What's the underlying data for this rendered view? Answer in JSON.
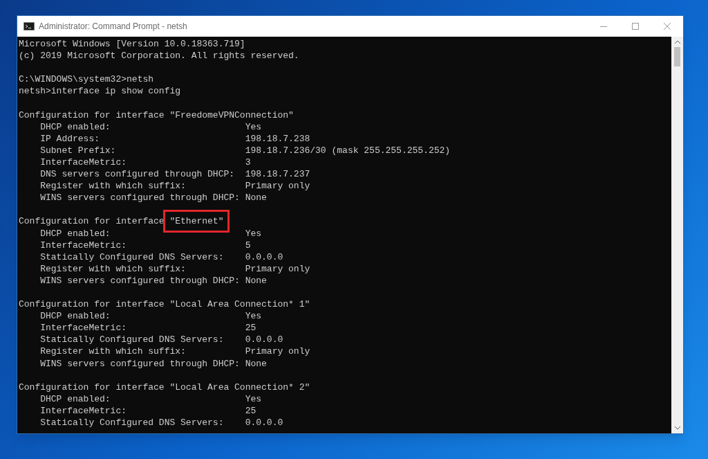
{
  "window": {
    "title": "Administrator: Command Prompt - netsh"
  },
  "console": {
    "lines": [
      {
        "kind": "text",
        "text": "Microsoft Windows [Version 10.0.18363.719]"
      },
      {
        "kind": "text",
        "text": "(c) 2019 Microsoft Corporation. All rights reserved."
      },
      {
        "kind": "blank"
      },
      {
        "kind": "text",
        "text": "C:\\WINDOWS\\system32>netsh"
      },
      {
        "kind": "text",
        "text": "netsh>interface ip show config"
      },
      {
        "kind": "blank"
      },
      {
        "kind": "text",
        "text": "Configuration for interface \"FreedomeVPNConnection\""
      },
      {
        "kind": "text",
        "text": "    DHCP enabled:                         Yes"
      },
      {
        "kind": "text",
        "text": "    IP Address:                           198.18.7.238"
      },
      {
        "kind": "text",
        "text": "    Subnet Prefix:                        198.18.7.236/30 (mask 255.255.255.252)"
      },
      {
        "kind": "text",
        "text": "    InterfaceMetric:                      3"
      },
      {
        "kind": "text",
        "text": "    DNS servers configured through DHCP:  198.18.7.237"
      },
      {
        "kind": "text",
        "text": "    Register with which suffix:           Primary only"
      },
      {
        "kind": "text",
        "text": "    WINS servers configured through DHCP: None"
      },
      {
        "kind": "blank"
      },
      {
        "kind": "parts",
        "parts": [
          {
            "text": "Configuration for interface ",
            "highlighted": false
          },
          {
            "text": "\"Ethernet\"",
            "highlighted": true
          }
        ]
      },
      {
        "kind": "text",
        "text": "    DHCP enabled:                         Yes"
      },
      {
        "kind": "text",
        "text": "    InterfaceMetric:                      5"
      },
      {
        "kind": "text",
        "text": "    Statically Configured DNS Servers:    0.0.0.0"
      },
      {
        "kind": "text",
        "text": "    Register with which suffix:           Primary only"
      },
      {
        "kind": "text",
        "text": "    WINS servers configured through DHCP: None"
      },
      {
        "kind": "blank"
      },
      {
        "kind": "text",
        "text": "Configuration for interface \"Local Area Connection* 1\""
      },
      {
        "kind": "text",
        "text": "    DHCP enabled:                         Yes"
      },
      {
        "kind": "text",
        "text": "    InterfaceMetric:                      25"
      },
      {
        "kind": "text",
        "text": "    Statically Configured DNS Servers:    0.0.0.0"
      },
      {
        "kind": "text",
        "text": "    Register with which suffix:           Primary only"
      },
      {
        "kind": "text",
        "text": "    WINS servers configured through DHCP: None"
      },
      {
        "kind": "blank"
      },
      {
        "kind": "text",
        "text": "Configuration for interface \"Local Area Connection* 2\""
      },
      {
        "kind": "text",
        "text": "    DHCP enabled:                         Yes"
      },
      {
        "kind": "text",
        "text": "    InterfaceMetric:                      25"
      },
      {
        "kind": "text",
        "text": "    Statically Configured DNS Servers:    0.0.0.0"
      }
    ]
  }
}
